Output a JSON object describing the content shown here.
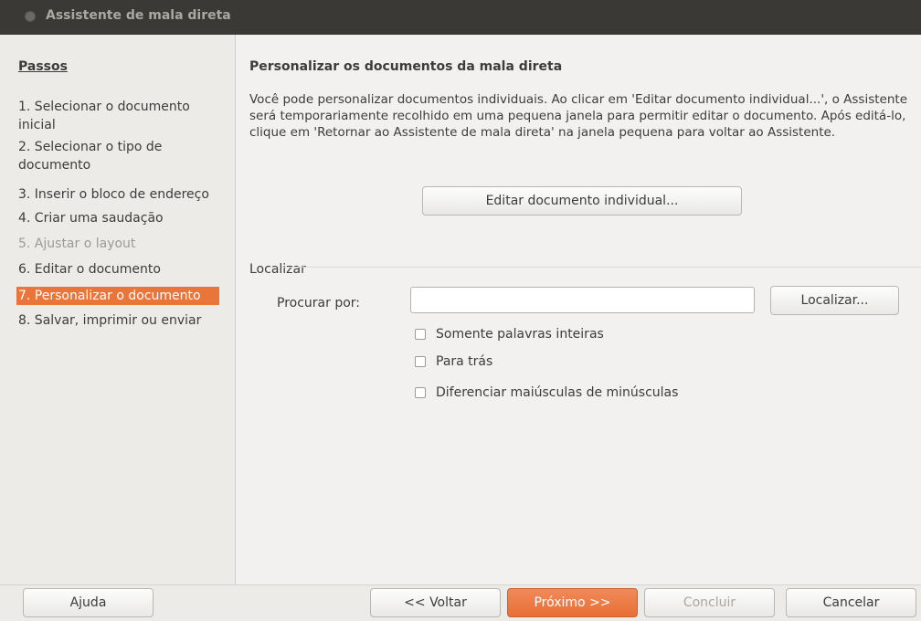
{
  "window": {
    "title": "Assistente de mala direta"
  },
  "sidebar": {
    "heading": "Passos",
    "steps": [
      {
        "label": "1. Selecionar o documento inicial",
        "state": "normal"
      },
      {
        "label": "2. Selecionar o tipo de documento",
        "state": "normal"
      },
      {
        "label": "3. Inserir o bloco de endereço",
        "state": "normal"
      },
      {
        "label": "4. Criar uma saudação",
        "state": "normal"
      },
      {
        "label": "5. Ajustar o layout",
        "state": "disabled"
      },
      {
        "label": "6. Editar o documento",
        "state": "normal"
      },
      {
        "label": "7. Personalizar o documento",
        "state": "active"
      },
      {
        "label": "8. Salvar, imprimir ou enviar",
        "state": "normal"
      }
    ]
  },
  "main": {
    "title": "Personalizar os documentos da mala direta",
    "description": "Você pode personalizar documentos individuais. Ao clicar em 'Editar documento individual...', o Assistente será temporariamente recolhido em uma pequena janela para permitir editar o documento. Após editá-lo, clique em 'Retornar ao Assistente de mala direta' na janela pequena para voltar ao Assistente.",
    "edit_button": "Editar documento individual...",
    "find": {
      "section_label": "Localizar",
      "search_label": "Procurar por:",
      "search_value": "",
      "find_button": "Localizar...",
      "options": [
        {
          "label": "Somente palavras inteiras",
          "checked": false
        },
        {
          "label": "Para trás",
          "checked": false
        },
        {
          "label": "Diferenciar maiúsculas de minúsculas",
          "checked": false
        }
      ]
    }
  },
  "footer": {
    "help": "Ajuda",
    "back": "<< Voltar",
    "next": "Próximo >>",
    "finish": "Concluir",
    "cancel": "Cancelar"
  },
  "colors": {
    "accent": "#e9753a",
    "titlebar": "#3a3935"
  }
}
